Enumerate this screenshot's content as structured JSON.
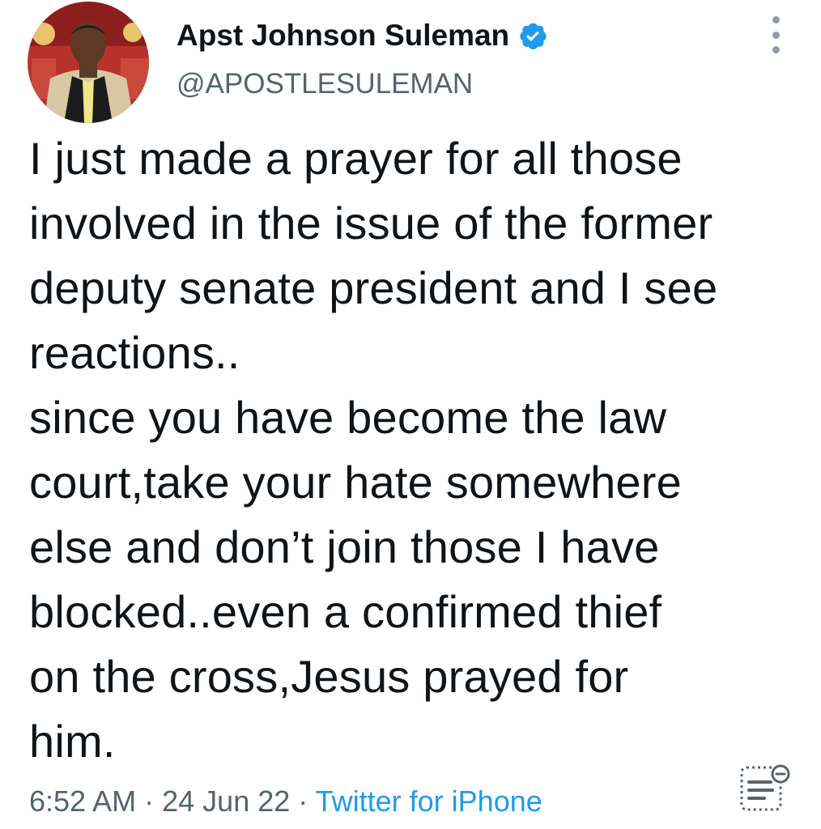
{
  "author": {
    "display_name": "Apst Johnson Suleman",
    "handle": "@APOSTLESULEMAN",
    "verified": true,
    "verified_icon": "verified-badge-icon",
    "avatar": "profile-photo"
  },
  "tweet": {
    "text": "I just made a prayer for all those\ninvolved in the issue of the former\ndeputy senate president and I see\nreactions..\nsince you have become the law\ncourt,take your hate somewhere\nelse and don’t join those I have\nblocked..even a confirmed thief\non the cross,Jesus prayed for\nhim.",
    "time": "6:52 AM",
    "separator": "·",
    "date": "24 Jun 22",
    "source": "Twitter for iPhone"
  },
  "icons": {
    "more": "more-vertical-icon",
    "analytics": "view-analytics-icon"
  },
  "colors": {
    "text": "#0f1419",
    "secondary": "#536471",
    "link": "#1d9bf0",
    "verified": "#1d9bf0"
  }
}
